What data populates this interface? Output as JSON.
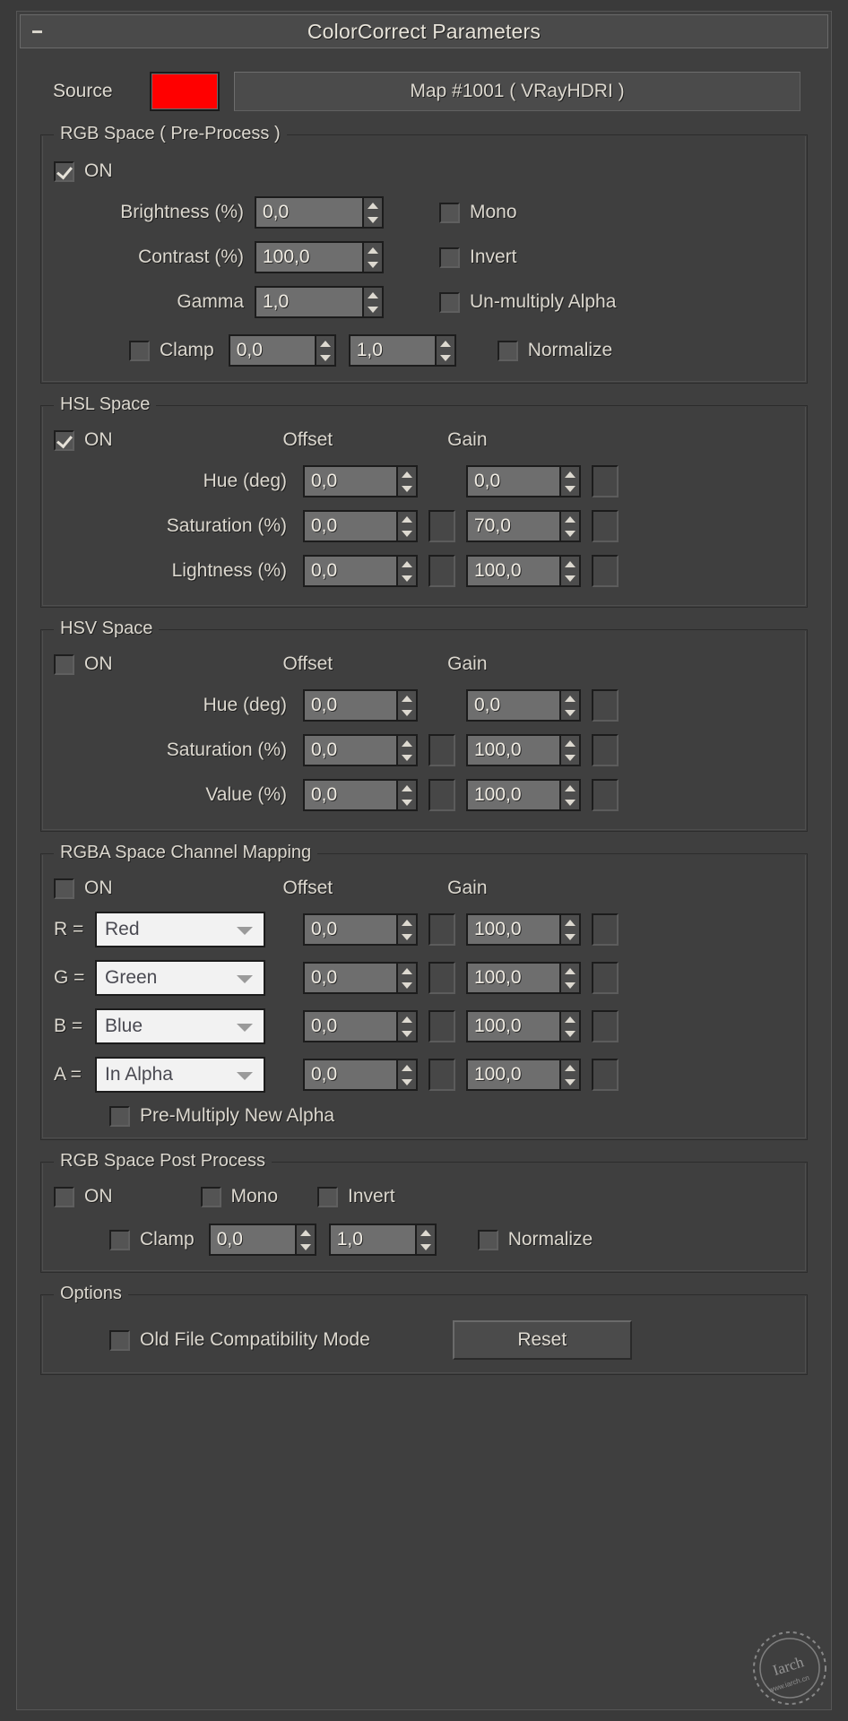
{
  "window": {
    "title": "ColorCorrect Parameters",
    "collapse_icon": "minus-icon"
  },
  "source": {
    "label": "Source",
    "color": "#ff0000",
    "map_button": "Map #1001  ( VRayHDRI )"
  },
  "rgb_pre": {
    "legend": "RGB Space ( Pre-Process )",
    "on_label": "ON",
    "on_checked": true,
    "rows": [
      {
        "label": "Brightness (%)",
        "value": "0,0"
      },
      {
        "label": "Contrast (%)",
        "value": "100,0"
      },
      {
        "label": "Gamma",
        "value": "1,0"
      }
    ],
    "toggles": [
      {
        "label": "Mono",
        "checked": false
      },
      {
        "label": "Invert",
        "checked": false
      },
      {
        "label": "Un-multiply Alpha",
        "checked": false
      }
    ],
    "clamp": {
      "label": "Clamp",
      "checked": false,
      "min": "0,0",
      "max": "1,0",
      "normalize_label": "Normalize",
      "normalize_checked": false
    }
  },
  "hsl": {
    "legend": "HSL Space",
    "on_label": "ON",
    "on_checked": true,
    "col_offset": "Offset",
    "col_gain": "Gain",
    "rows": [
      {
        "label": "Hue (deg)",
        "offset": "0,0",
        "gain": "0,0",
        "offset_map": false,
        "gain_map": true
      },
      {
        "label": "Saturation (%)",
        "offset": "0,0",
        "gain": "70,0",
        "offset_map": true,
        "gain_map": true
      },
      {
        "label": "Lightness (%)",
        "offset": "0,0",
        "gain": "100,0",
        "offset_map": true,
        "gain_map": true
      }
    ]
  },
  "hsv": {
    "legend": "HSV Space",
    "on_label": "ON",
    "on_checked": false,
    "col_offset": "Offset",
    "col_gain": "Gain",
    "rows": [
      {
        "label": "Hue (deg)",
        "offset": "0,0",
        "gain": "0,0",
        "offset_map": false,
        "gain_map": true
      },
      {
        "label": "Saturation (%)",
        "offset": "0,0",
        "gain": "100,0",
        "offset_map": true,
        "gain_map": true
      },
      {
        "label": "Value (%)",
        "offset": "0,0",
        "gain": "100,0",
        "offset_map": true,
        "gain_map": true
      }
    ]
  },
  "rgba": {
    "legend": "RGBA Space Channel Mapping",
    "on_label": "ON",
    "on_checked": false,
    "col_offset": "Offset",
    "col_gain": "Gain",
    "rows": [
      {
        "eq": "R =",
        "channel": "Red",
        "offset": "0,0",
        "gain": "100,0"
      },
      {
        "eq": "G =",
        "channel": "Green",
        "offset": "0,0",
        "gain": "100,0"
      },
      {
        "eq": "B =",
        "channel": "Blue",
        "offset": "0,0",
        "gain": "100,0"
      },
      {
        "eq": "A =",
        "channel": "In Alpha",
        "offset": "0,0",
        "gain": "100,0"
      }
    ],
    "premultiply": {
      "label": "Pre-Multiply New Alpha",
      "checked": false
    }
  },
  "rgb_post": {
    "legend": "RGB Space Post Process",
    "on_label": "ON",
    "on_checked": false,
    "mono_label": "Mono",
    "mono_checked": false,
    "invert_label": "Invert",
    "invert_checked": false,
    "clamp": {
      "label": "Clamp",
      "checked": false,
      "min": "0,0",
      "max": "1,0",
      "normalize_label": "Normalize",
      "normalize_checked": false
    }
  },
  "options": {
    "legend": "Options",
    "old_file_label": "Old File Compatibility Mode",
    "old_file_checked": false,
    "reset_label": "Reset"
  },
  "watermark": {
    "text": "Iarch",
    "subtext": "www.iarch.cn"
  }
}
